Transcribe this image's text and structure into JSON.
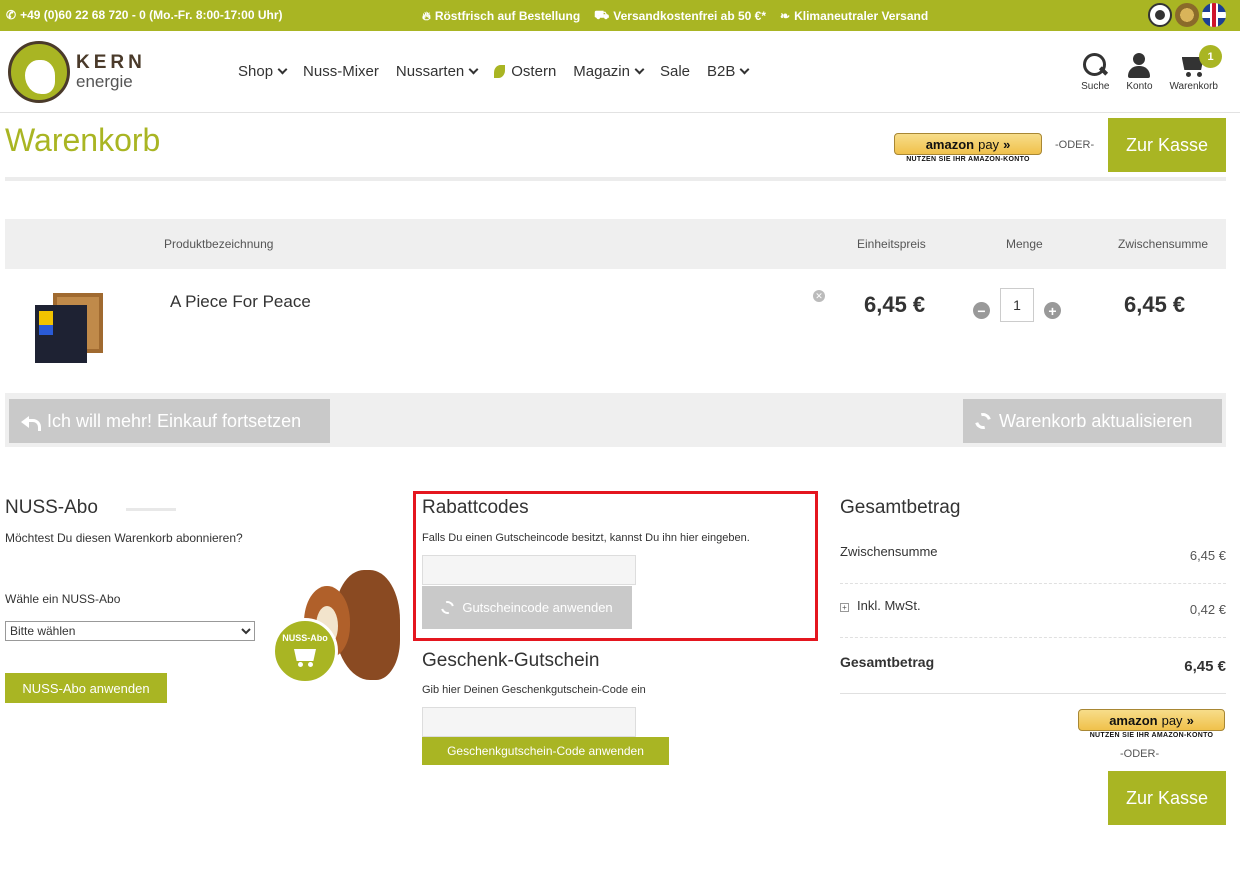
{
  "topbar": {
    "phone": "+49 (0)60 22 68 720 - 0 (Mo.-Fr. 8:00-17:00 Uhr)",
    "usps": [
      "Röstfrisch auf Bestellung",
      "Versandkostenfrei ab 50 €*",
      "Klimaneutraler Versand"
    ],
    "badge_icons": [
      "trusted-shops-icon",
      "award-seal-icon",
      "uk-flag-icon"
    ]
  },
  "header": {
    "logo_line1": "KERN",
    "logo_line2": "energie",
    "nav": [
      {
        "label": "Shop",
        "dropdown": true
      },
      {
        "label": "Nuss-Mixer",
        "dropdown": false
      },
      {
        "label": "Nussarten",
        "dropdown": true
      },
      {
        "label": "Ostern",
        "dropdown": false
      },
      {
        "label": "Magazin",
        "dropdown": true
      },
      {
        "label": "Sale",
        "dropdown": false
      },
      {
        "label": "B2B",
        "dropdown": true
      }
    ],
    "search_label": "Suche",
    "account_label": "Konto",
    "cart_label": "Warenkorb",
    "cart_count": "1"
  },
  "page": {
    "title": "Warenkorb",
    "oder": "-ODER-",
    "checkout_label": "Zur Kasse"
  },
  "amazon_pay": {
    "brand": "amazon",
    "pay": "pay",
    "subtext": "NUTZEN SIE IHR AMAZON-KONTO"
  },
  "table": {
    "headers": {
      "product": "Produktbezeichnung",
      "unit_price": "Einheitspreis",
      "quantity": "Menge",
      "subtotal": "Zwischensumme"
    },
    "items": [
      {
        "name": "A Piece For Peace",
        "unit_price": "6,45 €",
        "quantity": "1",
        "subtotal": "6,45 €"
      }
    ]
  },
  "actions": {
    "continue_label": "Ich will mehr! Einkauf fortsetzen",
    "update_label": "Warenkorb aktualisieren"
  },
  "abo": {
    "title": "NUSS-Abo",
    "question": "Möchtest Du diesen Warenkorb abonnieren?",
    "select_label": "Wähle ein NUSS-Abo",
    "select_value": "Bitte wählen",
    "apply_label": "NUSS-Abo anwenden",
    "badge": "NUSS-Abo"
  },
  "coupon": {
    "title": "Rabattcodes",
    "hint": "Falls Du einen Gutscheincode besitzt, kannst Du ihn hier eingeben.",
    "value": "",
    "apply_label": "Gutscheincode anwenden"
  },
  "gift": {
    "title": "Geschenk-Gutschein",
    "hint": "Gib hier Deinen Geschenkgutschein-Code ein",
    "value": "",
    "apply_label": "Geschenkgutschein-Code anwenden"
  },
  "totals": {
    "title": "Gesamtbetrag",
    "subtotal_label": "Zwischensumme",
    "subtotal_value": "6,45 €",
    "tax_label": "Inkl. MwSt.",
    "tax_value": "0,42 €",
    "total_label": "Gesamtbetrag",
    "total_value": "6,45 €"
  },
  "colors": {
    "brand_green": "#a9b523",
    "highlight_red": "#e4161f"
  }
}
